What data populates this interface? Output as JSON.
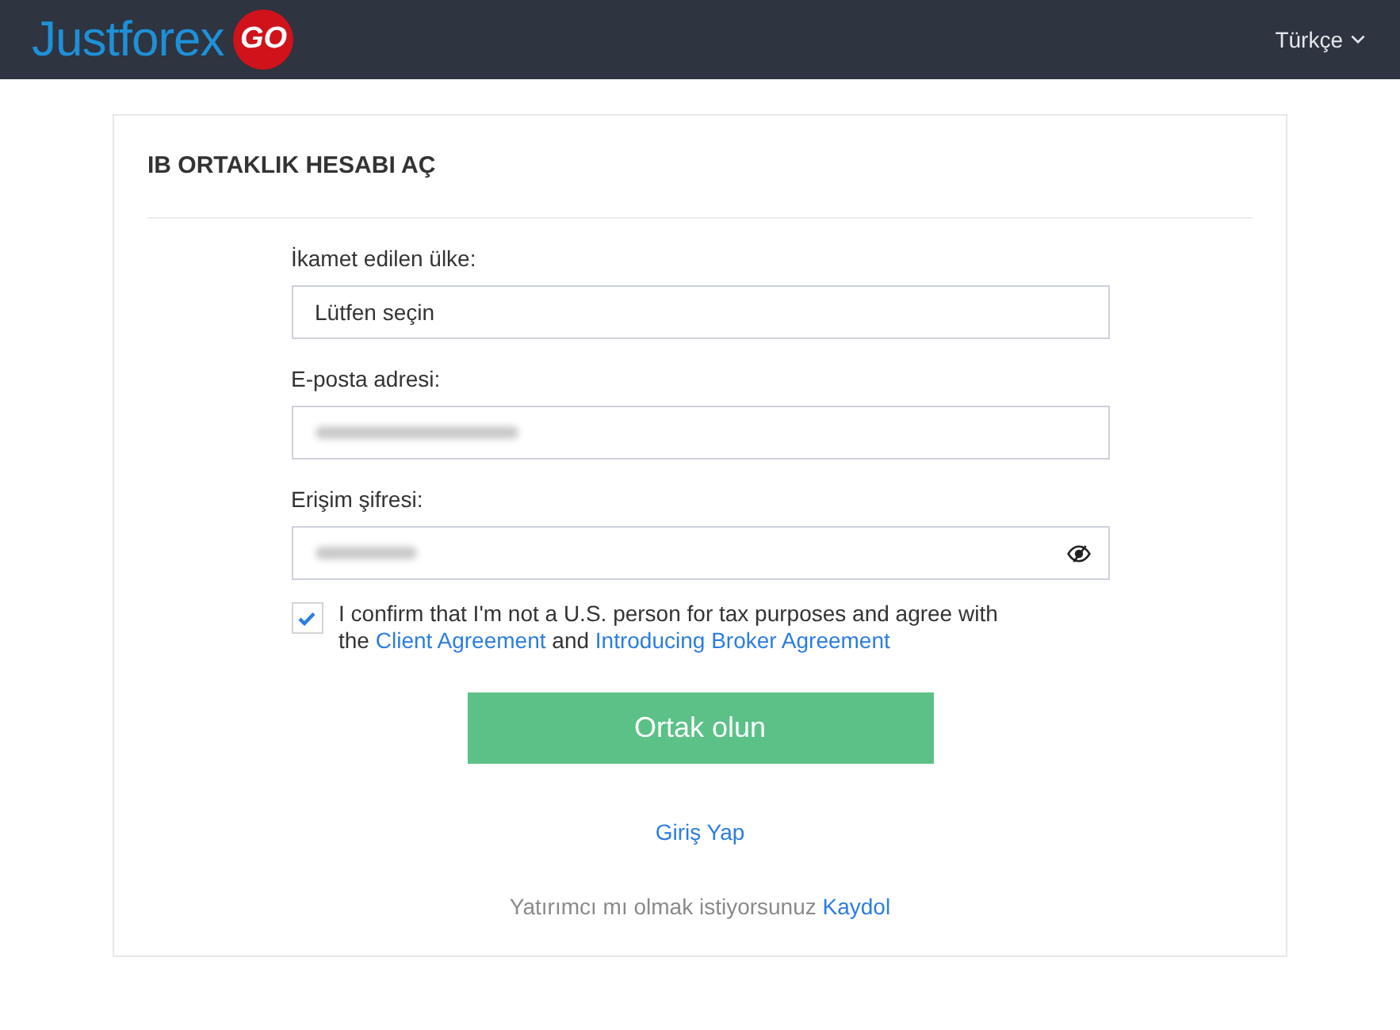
{
  "header": {
    "logo": {
      "text": "Justforex",
      "badge": "GO"
    },
    "language": "Türkçe"
  },
  "card": {
    "title": "IB ORTAKLIK HESABI AÇ",
    "fields": [
      {
        "kind": "select",
        "label": "İkamet edilen ülke:",
        "value": "Lütfen seçin"
      },
      {
        "kind": "email",
        "label": "E-posta adresi:",
        "blurred": true
      },
      {
        "kind": "password",
        "label": "Erişim şifresi:",
        "blurred": true
      }
    ],
    "consent": {
      "checked": true,
      "parts": [
        {
          "kind": "text",
          "text": "I confirm that I'm not a U.S. person for tax purposes and agree with the"
        },
        {
          "kind": "link",
          "text": "Client Agreement"
        },
        {
          "kind": "text",
          "text": "and"
        },
        {
          "kind": "link",
          "text": "Introducing Broker Agreement"
        }
      ]
    },
    "submit": "Ortak olun",
    "login_link": "Giriş Yap",
    "signup": {
      "text": "Yatırımcı mı olmak istiyorsunuz",
      "link": "Kaydol"
    }
  }
}
